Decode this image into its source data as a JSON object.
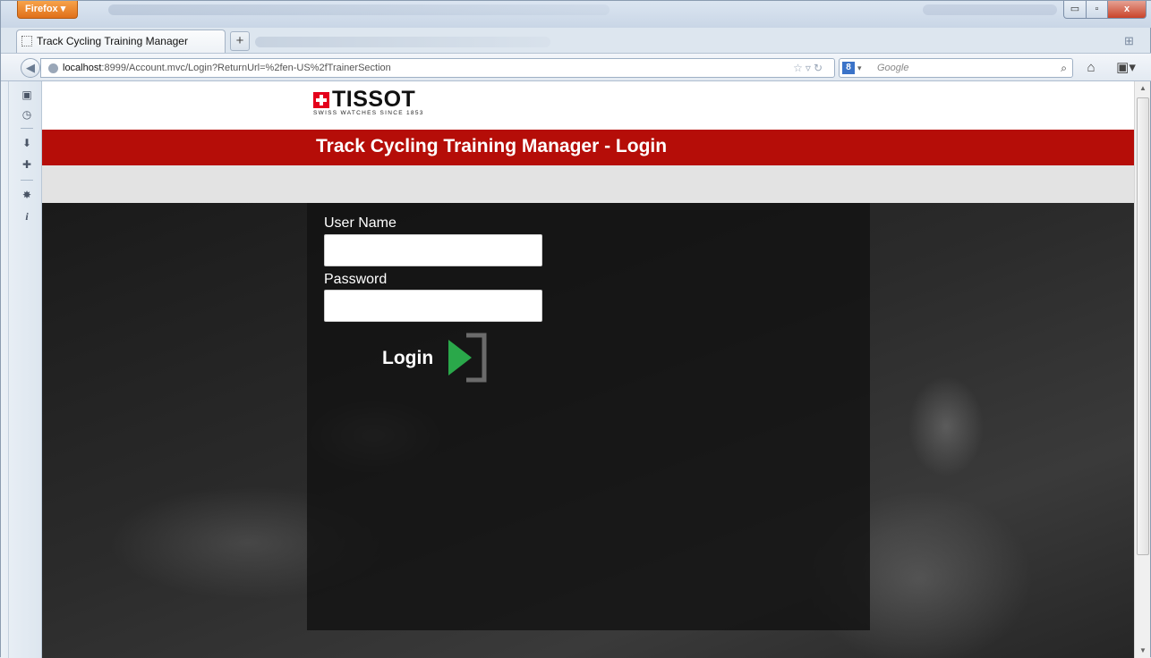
{
  "browser": {
    "menu_button": "Firefox ▾",
    "tab_title": "Track Cycling Training Manager",
    "new_tab": "+",
    "url_host": "localhost",
    "url_rest": ":8999/Account.mvc/Login?ReturnUrl=%2fen-US%2fTrainerSection",
    "search_engine_badge": "8",
    "search_placeholder": "Google",
    "window_controls": {
      "minimize": "▭",
      "maximize": "▫",
      "close": "x"
    }
  },
  "sidebar_icons": [
    "bookmarks-icon",
    "history-icon",
    "downloads-icon",
    "addons-icon",
    "web-developer-icon",
    "info-icon"
  ],
  "page": {
    "logo": {
      "word": "TISSOT",
      "tagline": "SWISS WATCHES SINCE 1853"
    },
    "header_title": "Track Cycling Training Manager - Login",
    "form": {
      "username_label": "User Name",
      "username_value": "",
      "password_label": "Password",
      "password_value": "",
      "login_label": "Login"
    }
  },
  "colors": {
    "header_red": "#b50d08",
    "subheader_grey": "#e3e3e3",
    "login_arrow_green": "#2aa84a",
    "login_frame_grey": "#6b6b6b"
  }
}
